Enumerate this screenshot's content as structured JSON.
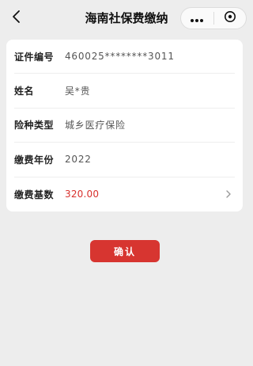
{
  "navbar": {
    "title": "海南社保费缴纳",
    "back_icon": "chevron-left-icon",
    "more_icon": "more-dots-icon",
    "close_icon": "close-circle-icon"
  },
  "form": {
    "rows": [
      {
        "label": "证件编号",
        "value": "460025********3011"
      },
      {
        "label": "姓名",
        "value": "吴*贵"
      },
      {
        "label": "险种类型",
        "value": "城乡医疗保险"
      },
      {
        "label": "缴费年份",
        "value": "2022"
      },
      {
        "label": "缴费基数",
        "value": "320.00"
      }
    ]
  },
  "actions": {
    "confirm_label": "确认"
  },
  "colors": {
    "background": "#ededed",
    "card": "#ffffff",
    "accent_red": "#d73530",
    "amount_red": "#d8302c"
  }
}
